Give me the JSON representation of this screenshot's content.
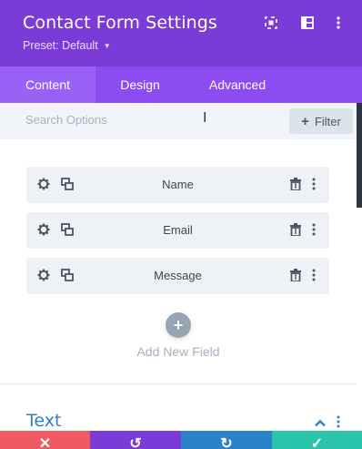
{
  "header": {
    "title": "Contact Form Settings",
    "preset_label": "Preset: Default",
    "icons": [
      "expand-icon",
      "sidebar-layout-icon",
      "more-vertical-icon"
    ],
    "color": "#7b3bd6"
  },
  "tabs": [
    {
      "label": "Content",
      "active": true
    },
    {
      "label": "Design",
      "active": false
    },
    {
      "label": "Advanced",
      "active": false
    }
  ],
  "search": {
    "placeholder": "Search Options",
    "filter_label": "Filter"
  },
  "fields": [
    {
      "label": "Name"
    },
    {
      "label": "Email"
    },
    {
      "label": "Message"
    }
  ],
  "add_field_label": "Add New Field",
  "section": {
    "title": "Text",
    "color": "#2c82c9"
  },
  "bottom_bar": [
    {
      "name": "discard",
      "icon": "close-icon",
      "color": "#ef5b63"
    },
    {
      "name": "undo",
      "icon": "undo-icon",
      "color": "#7b3bd6"
    },
    {
      "name": "redo",
      "icon": "redo-icon",
      "color": "#2c82c9"
    },
    {
      "name": "save",
      "icon": "check-icon",
      "color": "#29c4a9"
    }
  ]
}
